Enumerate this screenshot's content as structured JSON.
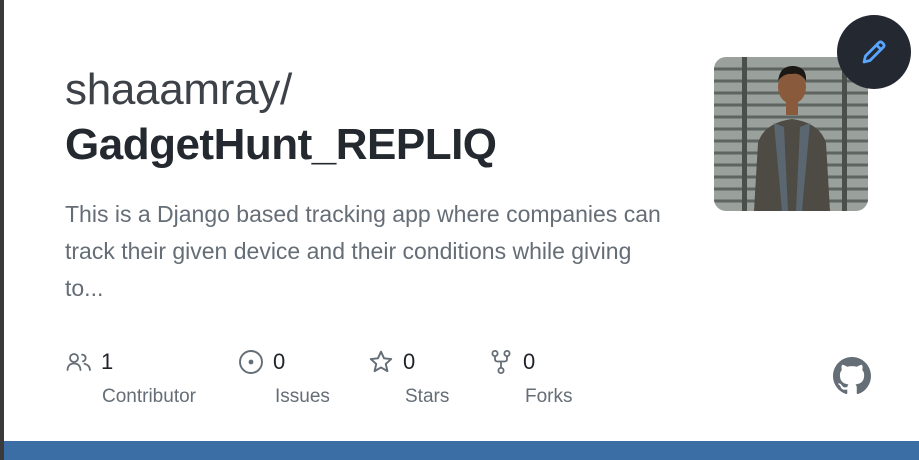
{
  "repo_card": {
    "owner": "shaaamray/",
    "repo_name": "GadgetHunt_REPLIQ",
    "description": "This is a Django based tracking app where companies can track their given device and their conditions while giving to..."
  },
  "stats": {
    "contributors": {
      "count": "1",
      "label": "Contributor",
      "icon": "people-icon"
    },
    "issues": {
      "count": "0",
      "label": "Issues",
      "icon": "issue-opened-icon"
    },
    "stars": {
      "count": "0",
      "label": "Stars",
      "icon": "star-icon"
    },
    "forks": {
      "count": "0",
      "label": "Forks",
      "icon": "repo-forked-icon"
    }
  },
  "icons": {
    "edit": "pencil-icon",
    "brand": "github-logo-icon"
  },
  "colors": {
    "edit_button_bg": "#242830",
    "edit_icon": "#58a6ff",
    "bottom_bar": "#3a6ea5",
    "muted_text": "#656d76"
  }
}
